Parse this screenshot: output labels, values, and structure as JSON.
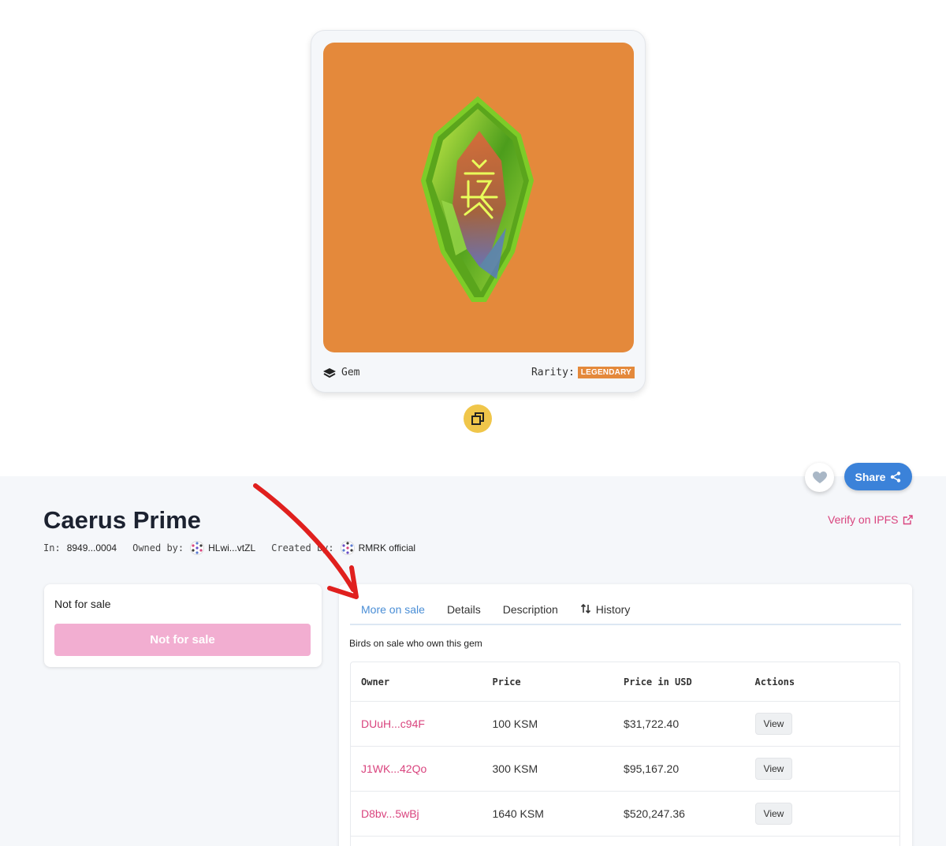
{
  "card": {
    "type_label": "Gem",
    "rarity_label": "Rarity:",
    "rarity_value": "LEGENDARY",
    "image_bg": "#e4893b",
    "icons": {
      "type": "layers-icon",
      "copy": "copy-icon"
    }
  },
  "item": {
    "title": "Caerus Prime",
    "in_label": "In:",
    "in_value": "8949...0004",
    "owned_label": "Owned by:",
    "owned_value": "HLwi...vtZL",
    "created_label": "Created by:",
    "created_value": "RMRK official"
  },
  "actions": {
    "share_label": "Share",
    "verify_label": "Verify on IPFS"
  },
  "sale": {
    "status": "Not for sale",
    "button_label": "Not for sale"
  },
  "tabs": [
    {
      "label": "More on sale",
      "active": true
    },
    {
      "label": "Details",
      "active": false
    },
    {
      "label": "Description",
      "active": false
    },
    {
      "label": "History",
      "active": false
    }
  ],
  "section_label": "Birds on sale who own this gem",
  "table": {
    "headers": [
      "Owner",
      "Price",
      "Price in USD",
      "Actions"
    ],
    "rows": [
      {
        "owner": "DUuH...c94F",
        "price": "100 KSM",
        "usd": "$31,722.40",
        "action": "View"
      },
      {
        "owner": "J1WK...42Qo",
        "price": "300 KSM",
        "usd": "$95,167.20",
        "action": "View"
      },
      {
        "owner": "D8bv...5wBj",
        "price": "1640 KSM",
        "usd": "$520,247.36",
        "action": "View"
      }
    ]
  },
  "colors": {
    "accent_pink": "#d9447e",
    "share_blue": "#3b82d9",
    "legendary_orange": "#e4893b",
    "copy_yellow": "#f0c64a",
    "annotation_red": "#e0201e"
  }
}
